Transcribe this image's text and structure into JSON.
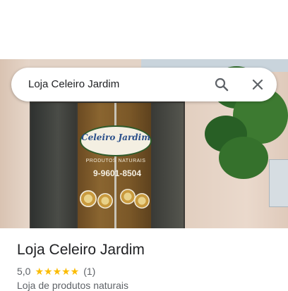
{
  "search": {
    "query": "Loja Celeiro Jardim"
  },
  "photo": {
    "sign_name": "Celeiro Jardim",
    "sign_subtitle": "PRODUTOS NATURAIS",
    "sign_phone": "9-9601-8504"
  },
  "place": {
    "title": "Loja Celeiro Jardim",
    "rating": "5,0",
    "stars": "★★★★★",
    "review_count": "(1)",
    "category": "Loja de produtos naturais"
  },
  "colors": {
    "star": "#fbbc04",
    "title": "#202124",
    "secondary_text": "#5f6368"
  }
}
